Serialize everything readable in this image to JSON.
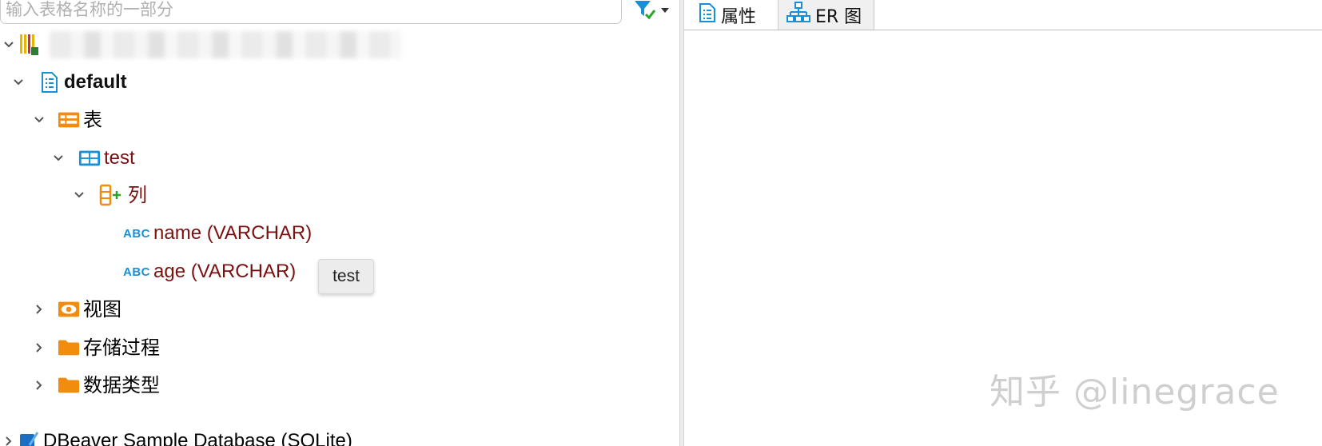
{
  "filter": {
    "placeholder": "输入表格名称的一部分"
  },
  "tree": {
    "connection_label": "",
    "schema": "default",
    "tables_folder": "表",
    "table": "test",
    "columns_folder": "列",
    "columns": [
      {
        "label": "name (VARCHAR)",
        "type_badge": "ABC"
      },
      {
        "label": "age (VARCHAR)",
        "type_badge": "ABC"
      }
    ],
    "views_folder": "视图",
    "procedures_folder": "存储过程",
    "datatypes_folder": "数据类型",
    "sample_db": "DBeaver Sample Database (SQLite)"
  },
  "tooltip": "test",
  "tabs": [
    {
      "label": "属性"
    },
    {
      "label": "ER 图"
    }
  ],
  "watermark": "知乎 @linegrace",
  "colors": {
    "folder_orange": "#f28c0f",
    "table_blue": "#1b8fd6",
    "object_red": "#7a1010"
  }
}
